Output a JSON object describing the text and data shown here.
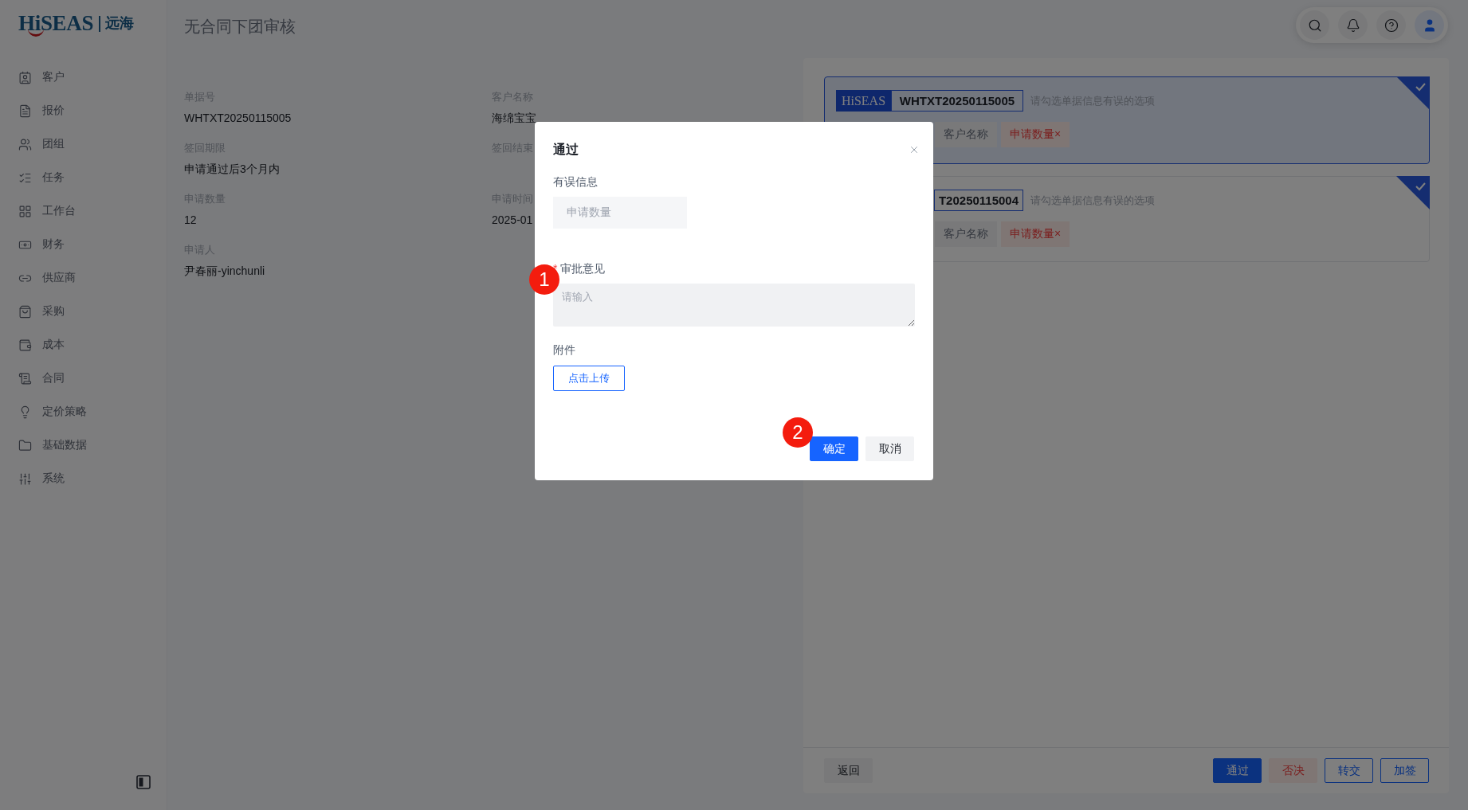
{
  "logo": {
    "wordmark": "HiSEAS",
    "name": "远海"
  },
  "sidebar": {
    "items": [
      {
        "label": "客户"
      },
      {
        "label": "报价"
      },
      {
        "label": "团组"
      },
      {
        "label": "任务"
      },
      {
        "label": "工作台"
      },
      {
        "label": "财务"
      },
      {
        "label": "供应商"
      },
      {
        "label": "采购"
      },
      {
        "label": "成本"
      },
      {
        "label": "合同"
      },
      {
        "label": "定价策略"
      },
      {
        "label": "基础数据"
      },
      {
        "label": "系统"
      }
    ]
  },
  "page": {
    "title": "无合同下团审核"
  },
  "details": {
    "fields": [
      {
        "label": "单据号",
        "value": "WHTXT20250115005"
      },
      {
        "label": "客户名称",
        "value": "海绵宝宝"
      },
      {
        "label": "签回期限",
        "value": "申请通过后3个月内"
      },
      {
        "label": "签回结束"
      },
      {
        "label": "申请数量",
        "value": "12"
      },
      {
        "label": "申请时间",
        "value": "2025-01"
      },
      {
        "label": "申请人",
        "value": "尹春丽-yinchunli"
      }
    ]
  },
  "review_panel": {
    "cards": [
      {
        "badge": "HiSEAS",
        "number": "WHTXT20250115005",
        "hint": "请勾选单据信息有误的选项",
        "selected": true,
        "checked": true,
        "tags": [
          {
            "label": "客户名称",
            "flagged": false
          },
          {
            "label": "申请数量",
            "flagged": true,
            "icon": "×"
          }
        ]
      },
      {
        "number": "T20250115004",
        "hint": "请勾选单据信息有误的选项",
        "selected": false,
        "checked": true,
        "tags": [
          {
            "label": "客户名称",
            "flagged": false
          },
          {
            "label": "申请数量",
            "flagged": true,
            "icon": "×"
          }
        ]
      }
    ]
  },
  "actions": {
    "back": "返回",
    "buttons": [
      {
        "label": "通过",
        "kind": "primary"
      },
      {
        "label": "否决",
        "kind": "danger"
      },
      {
        "label": "转交",
        "kind": "outline"
      },
      {
        "label": "加签",
        "kind": "outline"
      }
    ]
  },
  "dialog": {
    "title": "通过",
    "error_info": {
      "label": "有误信息",
      "items": [
        "申请数量"
      ]
    },
    "opinion": {
      "label": "审批意见",
      "required_mark": "*",
      "placeholder": "请输入"
    },
    "attachment": {
      "label": "附件",
      "button": "点击上传"
    },
    "buttons": [
      {
        "label": "确定",
        "kind": "primary"
      },
      {
        "label": "取消",
        "kind": "default"
      }
    ]
  },
  "annotations": [
    {
      "label": "1"
    },
    {
      "label": "2"
    }
  ]
}
